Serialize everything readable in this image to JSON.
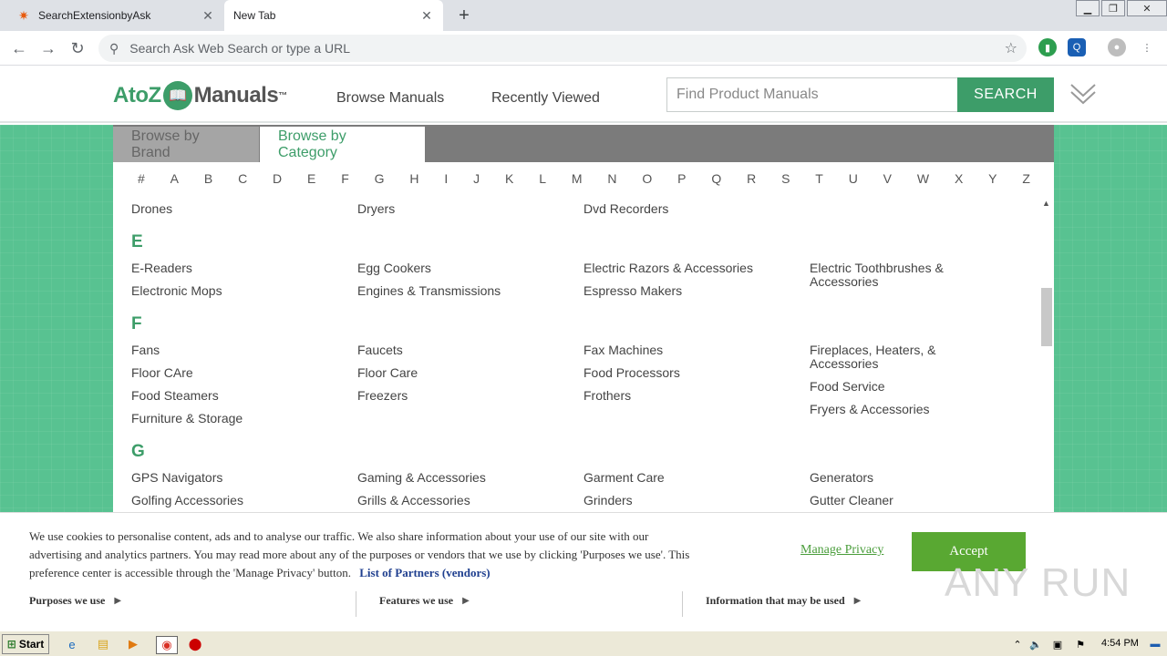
{
  "browser": {
    "tabs": [
      {
        "title": "SearchExtensionbyAsk",
        "active": false
      },
      {
        "title": "New Tab",
        "active": true
      }
    ],
    "omnibox_placeholder": "Search Ask Web Search or type a URL"
  },
  "site": {
    "logo": {
      "part1": "AtoZ",
      "part2": "Manuals",
      "tm": "™"
    },
    "nav": {
      "browse": "Browse Manuals",
      "recent": "Recently Viewed"
    },
    "search_placeholder": "Find Product Manuals",
    "search_button": "SEARCH"
  },
  "browse_tabs": {
    "brand": "Browse by Brand",
    "category": "Browse by Category"
  },
  "letters": [
    "#",
    "A",
    "B",
    "C",
    "D",
    "E",
    "F",
    "G",
    "H",
    "I",
    "J",
    "K",
    "L",
    "M",
    "N",
    "O",
    "P",
    "Q",
    "R",
    "S",
    "T",
    "U",
    "V",
    "W",
    "X",
    "Y",
    "Z"
  ],
  "categories": {
    "d_tail": [
      "Drones",
      "Dryers",
      "Dvd Recorders"
    ],
    "E": {
      "heading": "E",
      "rows": [
        [
          "E-Readers",
          "Egg Cookers",
          "Electric Razors & Accessories",
          "Electric Toothbrushes & Accessories"
        ],
        [
          "Electronic Mops",
          "Engines & Transmissions",
          "Espresso Makers",
          ""
        ]
      ]
    },
    "F": {
      "heading": "F",
      "col1": [
        "Fans",
        "Floor CAre",
        "Food Steamers",
        "Furniture & Storage"
      ],
      "col2": [
        "Faucets",
        "Floor Care",
        "Freezers"
      ],
      "col3": [
        "Fax Machines",
        "Food Processors",
        "Frothers"
      ],
      "col4": [
        "Fireplaces, Heaters, & Accessories",
        "Food Service",
        "Fryers & Accessories"
      ]
    },
    "G": {
      "heading": "G",
      "rows": [
        [
          "GPS Navigators",
          "Gaming & Accessories",
          "Garment Care",
          "Generators"
        ],
        [
          "Golfing Accessories",
          "Grills & Accessories",
          "Grinders",
          "Gutter Cleaner"
        ]
      ]
    }
  },
  "cookie": {
    "text": "We use cookies to personalise content, ads and to analyse our traffic. We also share information about your use of our site with our advertising and analytics partners. You may read more about any of the purposes or vendors that we use by clicking 'Purposes we use'. This preference center is accessible through the 'Manage Privacy' button.",
    "partners_link": "List of Partners (vendors)",
    "manage": "Manage Privacy",
    "accept": "Accept",
    "purposes": "Purposes we use",
    "features": "Features we use",
    "info": "Information that may be used"
  },
  "watermark": "ANY RUN",
  "taskbar": {
    "start": "Start",
    "time": "4:54 PM"
  },
  "colors": {
    "brand_green": "#3d9d69",
    "bg_green": "#58c291",
    "accept_green": "#59a832"
  }
}
